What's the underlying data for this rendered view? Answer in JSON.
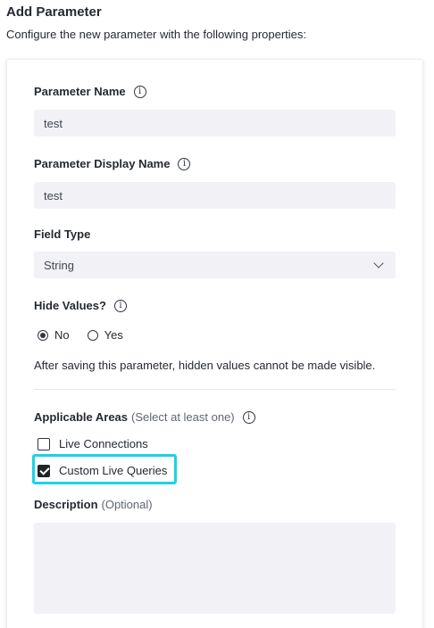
{
  "header": {
    "title": "Add Parameter",
    "subtitle": "Configure the new parameter with the following properties:"
  },
  "form": {
    "parameter_name": {
      "label": "Parameter Name",
      "value": "test",
      "info_icon": "info-icon"
    },
    "display_name": {
      "label": "Parameter Display Name",
      "value": "test",
      "info_icon": "info-icon"
    },
    "field_type": {
      "label": "Field Type",
      "selected": "String",
      "icon": "chevron-down-icon"
    },
    "hide_values": {
      "label": "Hide Values?",
      "info_icon": "info-icon",
      "options": [
        {
          "label": "No",
          "checked": true
        },
        {
          "label": "Yes",
          "checked": false
        }
      ],
      "note": "After saving this parameter, hidden values cannot be made visible."
    },
    "applicable_areas": {
      "label": "Applicable Areas",
      "hint": "(Select at least one)",
      "info_icon": "info-icon",
      "options": [
        {
          "label": "Live Connections",
          "checked": false
        },
        {
          "label": "Custom Live Queries",
          "checked": true
        }
      ],
      "highlight_color": "#19d3e6"
    },
    "description": {
      "label": "Description",
      "hint": "(Optional)",
      "value": ""
    }
  }
}
